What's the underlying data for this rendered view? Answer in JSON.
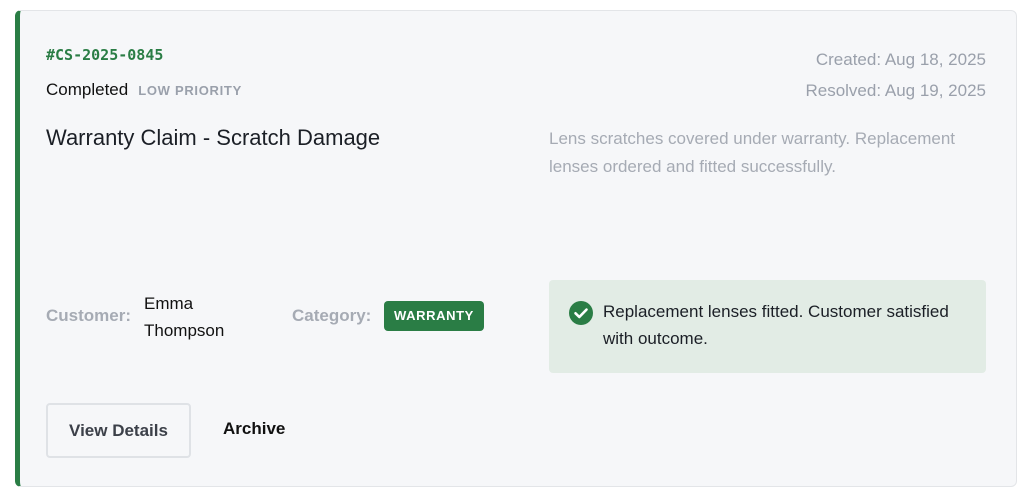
{
  "ticket": {
    "id": "#CS-2025-0845",
    "status": "Completed",
    "priority": "LOW PRIORITY",
    "created": "Created: Aug 18, 2025",
    "resolved": "Resolved: Aug 19, 2025",
    "title": "Warranty Claim - Scratch Damage",
    "description": "Lens scratches covered under warranty. Replacement lenses ordered and fitted successfully.",
    "customer_label": "Customer:",
    "customer_name": "Emma Thompson",
    "category_label": "Category:",
    "category": "WARRANTY",
    "resolution_note": "Replacement lenses fitted. Customer satisfied with outcome.",
    "resolution_icon": "check-circle-icon"
  },
  "actions": {
    "view_details_label": "View Details",
    "archive_label": "Archive"
  },
  "colors": {
    "accent": "#2a7d45",
    "card_background": "#f6f7f9",
    "note_background": "#e2ece5",
    "muted_text": "#9aa0ab"
  }
}
